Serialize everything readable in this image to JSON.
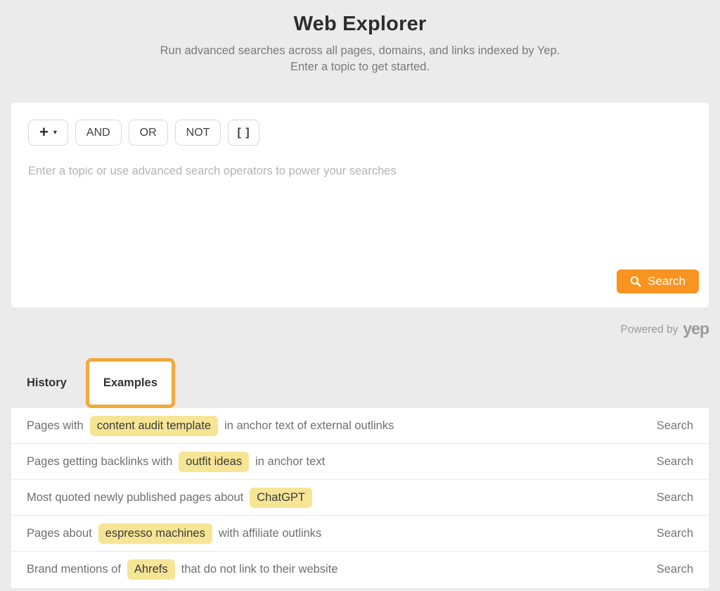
{
  "header": {
    "title": "Web Explorer",
    "subtitle_line1": "Run advanced searches across all pages, domains, and links indexed by Yep.",
    "subtitle_line2": "Enter a topic to get started."
  },
  "search_box": {
    "operators": {
      "add": "+",
      "and": "AND",
      "or": "OR",
      "not": "NOT",
      "brackets": "[ ]"
    },
    "placeholder": "Enter a topic or use advanced search operators to power your searches",
    "search_button": "Search"
  },
  "icons": {
    "caret_down": "▾"
  },
  "powered_by": {
    "text": "Powered by",
    "brand": "yep"
  },
  "tabs": {
    "history": "History",
    "examples": "Examples"
  },
  "examples": [
    {
      "prefix": "Pages with",
      "term": "content audit template",
      "suffix": "in anchor text of external outlinks",
      "action": "Search"
    },
    {
      "prefix": "Pages getting backlinks with",
      "term": "outfit ideas",
      "suffix": "in anchor text",
      "action": "Search"
    },
    {
      "prefix": "Most quoted newly published pages about",
      "term": "ChatGPT",
      "suffix": "",
      "action": "Search"
    },
    {
      "prefix": "Pages about",
      "term": "espresso machines",
      "suffix": "with affiliate outlinks",
      "action": "Search"
    },
    {
      "prefix": "Brand mentions of",
      "term": "Ahrefs",
      "suffix": "that do not link to their website",
      "action": "Search"
    }
  ],
  "colors": {
    "page_background": "#ebebeb",
    "accent_orange": "#f8941f",
    "tab_highlight_border": "#f2a93c",
    "term_highlight": "#f7e596"
  }
}
